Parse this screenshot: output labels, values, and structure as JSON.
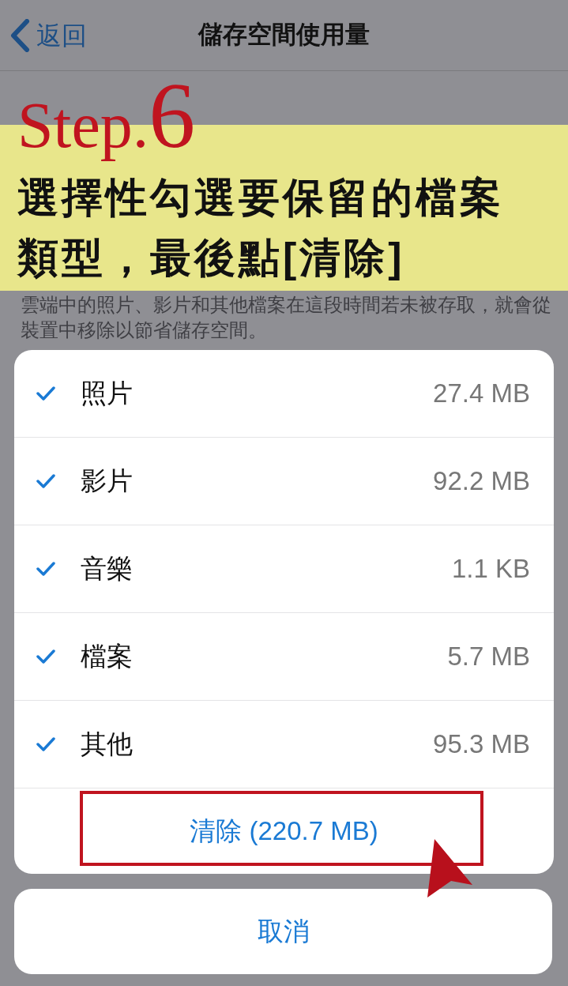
{
  "nav": {
    "back": "返回",
    "title": "儲存空間使用量"
  },
  "description": "雲端中的照片、影片和其他檔案在這段時間若未被存取，就會從裝置中移除以節省儲存空間。",
  "items": [
    {
      "label": "照片",
      "size": "27.4 MB",
      "checked": true
    },
    {
      "label": "影片",
      "size": "92.2 MB",
      "checked": true
    },
    {
      "label": "音樂",
      "size": "1.1 KB",
      "checked": true
    },
    {
      "label": "檔案",
      "size": "5.7 MB",
      "checked": true
    },
    {
      "label": "其他",
      "size": "95.3 MB",
      "checked": true
    }
  ],
  "clear_button": "清除 (220.7 MB)",
  "cancel_button": "取消",
  "annotation": {
    "step": "Step.",
    "number": "6",
    "lines": [
      "選擇性勾選要保留的檔案",
      "類型，最後點[清除]"
    ]
  }
}
